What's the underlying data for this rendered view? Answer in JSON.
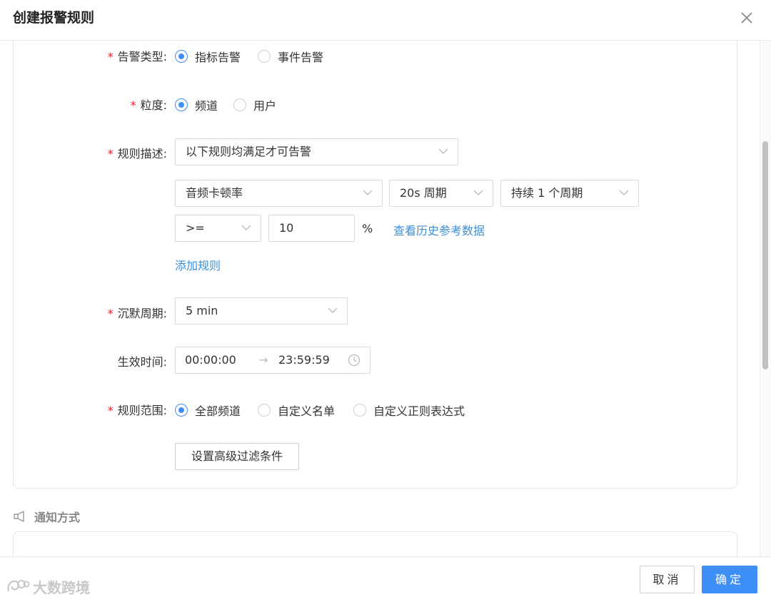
{
  "dialog": {
    "title": "创建报警规则"
  },
  "form": {
    "alert_type": {
      "label": "告警类型",
      "options": [
        "指标告警",
        "事件告警"
      ],
      "selected": "指标告警"
    },
    "granularity": {
      "label": "粒度",
      "options": [
        "频道",
        "用户"
      ],
      "selected": "频道"
    },
    "rule_desc": {
      "label": "规则描述",
      "mode": "以下规则均满足才可告警",
      "metric": "音频卡顿率",
      "period": "20s 周期",
      "duration": "持续 1 个周期",
      "operator": ">=",
      "threshold": "10",
      "unit": "%",
      "history_link": "查看历史参考数据",
      "add_rule": "添加规则"
    },
    "silence": {
      "label": "沉默周期",
      "value": "5 min"
    },
    "effective_time": {
      "label": "生效时间",
      "start": "00:00:00",
      "arrow": "→",
      "end": "23:59:59"
    },
    "scope": {
      "label": "规则范围",
      "options": [
        "全部频道",
        "自定义名单",
        "自定义正则表达式"
      ],
      "selected": "全部频道"
    },
    "advanced_filter": "设置高级过滤条件",
    "colon": ":"
  },
  "notify": {
    "title": "通知方式"
  },
  "footer": {
    "cancel": "取消",
    "ok": "确定",
    "watermark": "大数跨境"
  },
  "colors": {
    "primary": "#3e8ef7",
    "required": "#f5222d",
    "link": "#3b8fd8"
  }
}
